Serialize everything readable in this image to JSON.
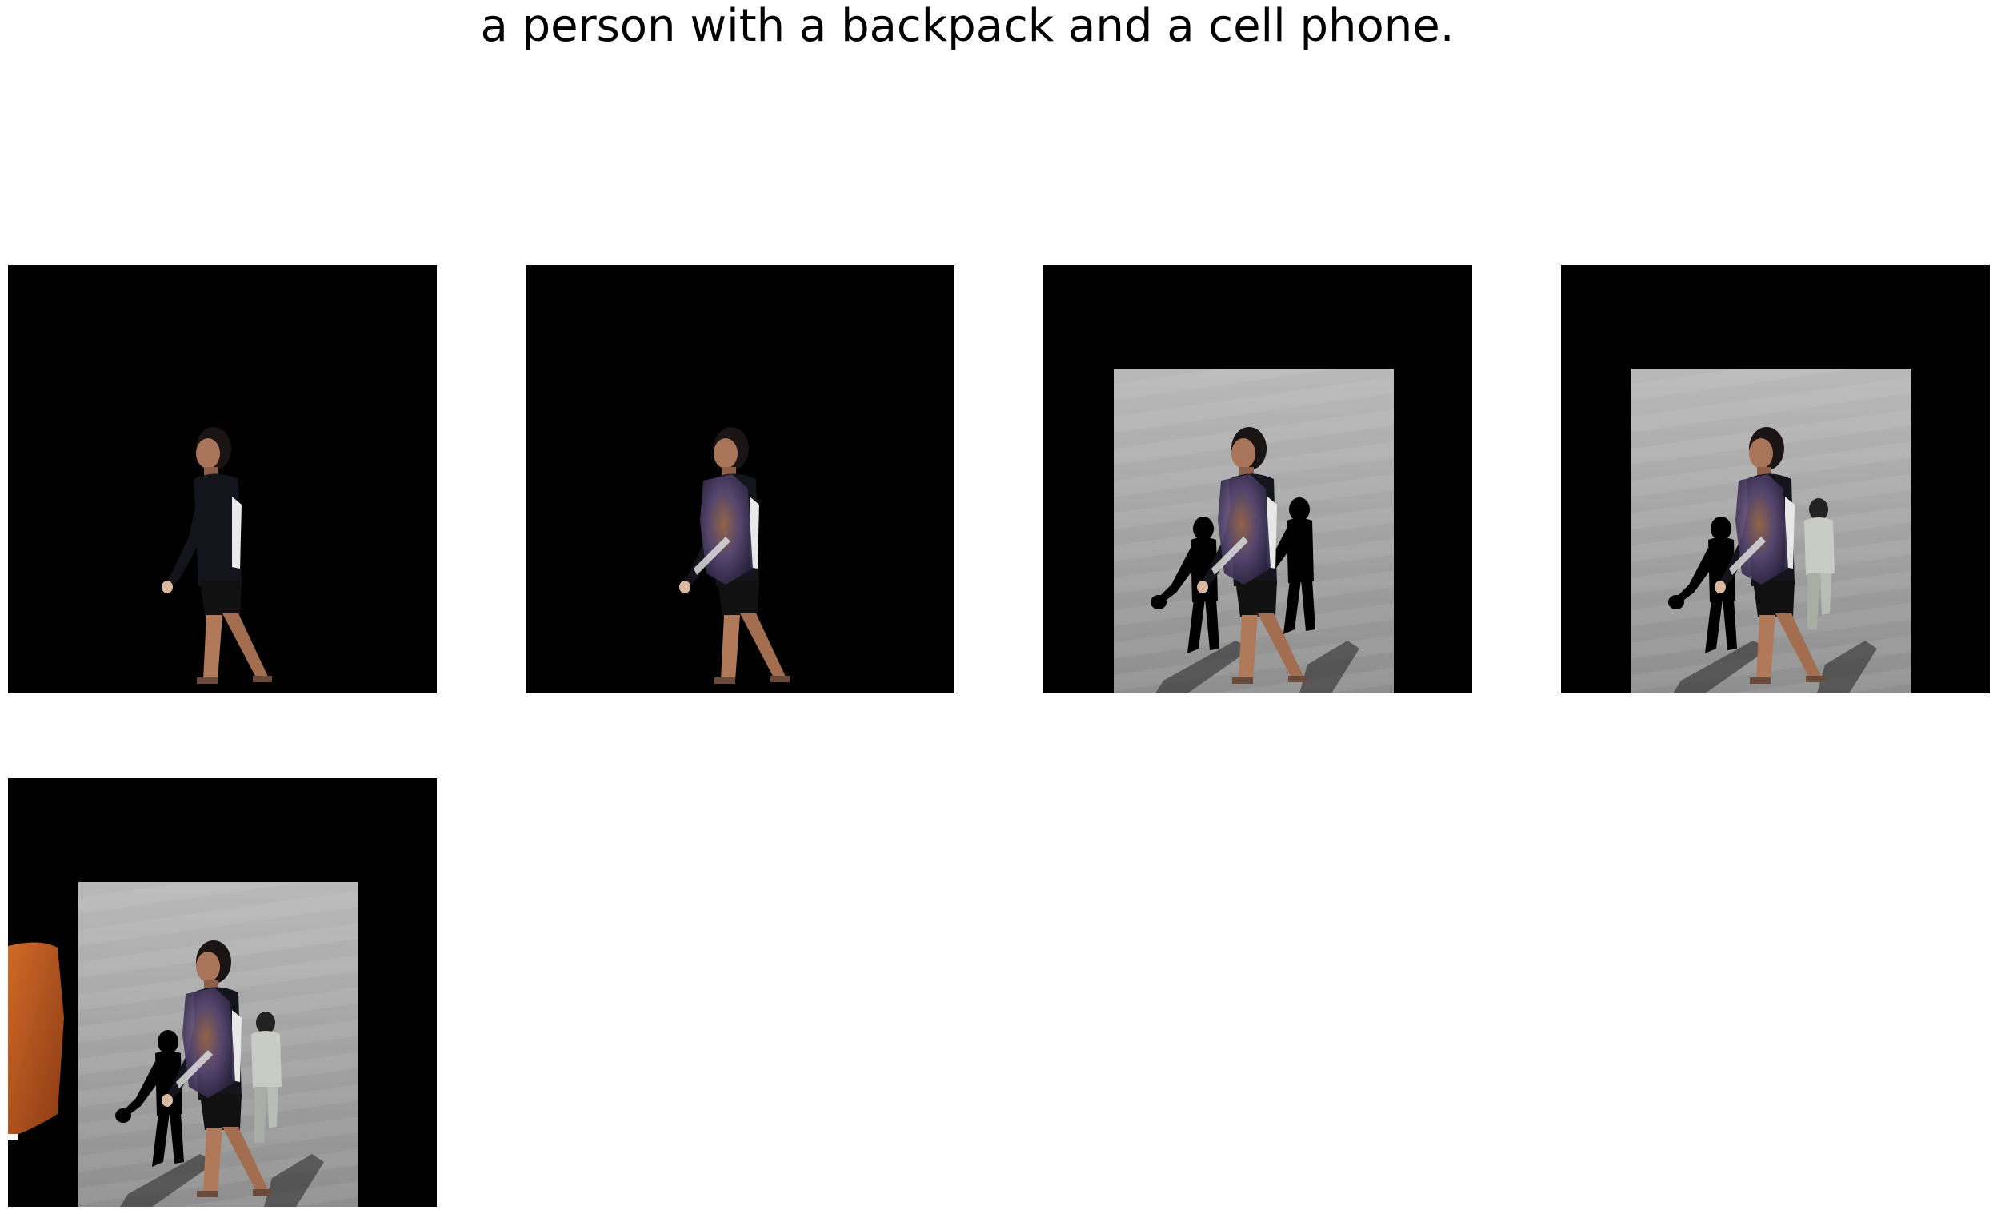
{
  "figure": {
    "title": "a person with a backpack and a cell phone."
  },
  "panels": [
    {
      "id": 1,
      "background": "black",
      "contents": [
        "person"
      ]
    },
    {
      "id": 2,
      "background": "black",
      "contents": [
        "person",
        "backpack overlay"
      ]
    },
    {
      "id": 3,
      "background": "grey pavement",
      "contents": [
        "person",
        "backpack overlay",
        "black silhouettes"
      ]
    },
    {
      "id": 4,
      "background": "grey pavement",
      "contents": [
        "person",
        "backpack overlay",
        "black silhouette",
        "grey figure"
      ]
    },
    {
      "id": 5,
      "background": "grey pavement",
      "contents": [
        "person",
        "backpack overlay",
        "black silhouette",
        "grey figure",
        "orange patch"
      ]
    }
  ],
  "colors": {
    "background": "#ffffff",
    "panel_fill": "#000000",
    "pavement": "#9a9a9a",
    "skin": "#b07a5a",
    "clothes": "#14141c",
    "backpack": "#5a4a74",
    "orange_patch": "#b9531c"
  }
}
